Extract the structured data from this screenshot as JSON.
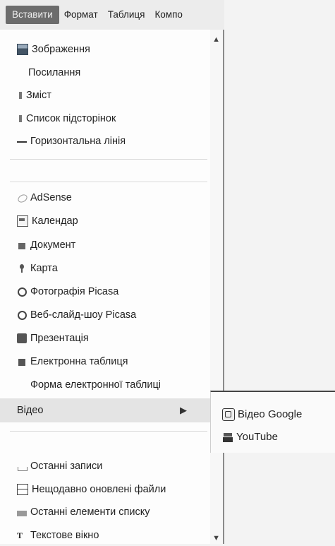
{
  "menubar": {
    "menus": [
      "Вставити",
      "Формат",
      "Таблиця",
      "Компо"
    ]
  },
  "insert_menu": {
    "items": [
      {
        "label": "Зображення",
        "icon": "image-icon"
      },
      {
        "label": "Посилання",
        "icon": "none"
      },
      {
        "label": "Зміст",
        "icon": "toc-icon"
      },
      {
        "label": "Список підсторінок",
        "icon": "subpages-icon"
      },
      {
        "label": "Горизонтальна лінія",
        "icon": "horizontal-line-icon"
      }
    ],
    "gadgets": [
      {
        "label": "AdSense",
        "icon": "adsense-icon"
      },
      {
        "label": "Календар",
        "icon": "calendar-icon"
      },
      {
        "label": "Документ",
        "icon": "document-icon"
      },
      {
        "label": "Карта",
        "icon": "map-pin-icon"
      },
      {
        "label": "Фотографія Picasa",
        "icon": "picasa-icon"
      },
      {
        "label": "Веб-слайд-шоу Picasa",
        "icon": "picasa-slideshow-icon"
      },
      {
        "label": "Презентація",
        "icon": "presentation-icon"
      },
      {
        "label": "Електронна таблиця",
        "icon": "spreadsheet-icon"
      },
      {
        "label": "Форма електронної таблиці",
        "icon": "none"
      }
    ],
    "video": {
      "label": "Відео",
      "arrow": "▶"
    },
    "recent": [
      {
        "label": "Останні записи",
        "icon": "recent-posts-icon"
      },
      {
        "label": "Нещодавно оновлені файли",
        "icon": "recent-files-icon"
      },
      {
        "label": "Останні елементи списку",
        "icon": "list-items-icon"
      },
      {
        "label": "Текстове вікно",
        "icon": "text-box-icon",
        "glyph": "T"
      }
    ]
  },
  "video_submenu": {
    "items": [
      {
        "label": "Відео Google",
        "icon": "google-video-icon"
      },
      {
        "label": "YouTube",
        "icon": "youtube-icon"
      }
    ]
  },
  "scrollbar": {
    "up": "▲",
    "down": "▼"
  }
}
